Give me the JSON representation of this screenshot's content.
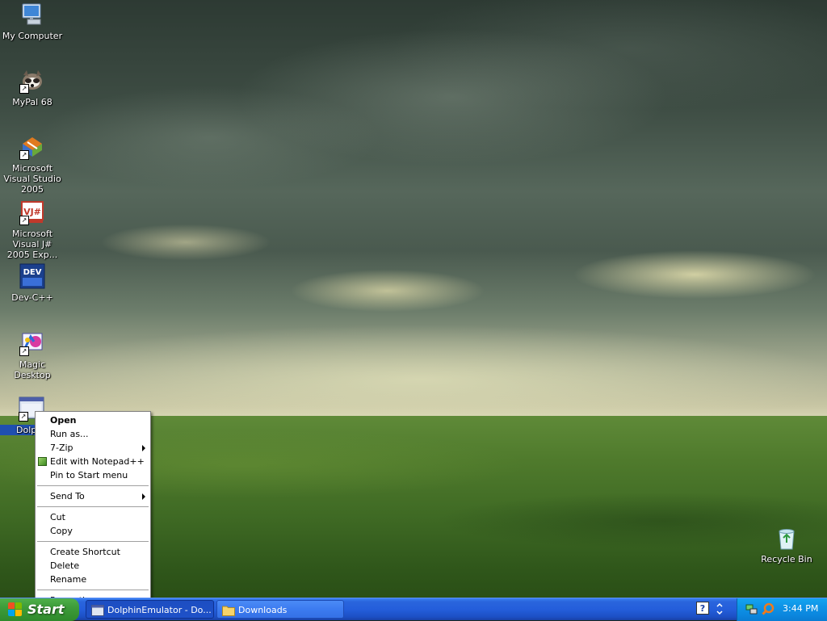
{
  "desktop": {
    "icons": [
      {
        "label": "My Computer"
      },
      {
        "label": "MyPal 68"
      },
      {
        "label": "Microsoft Visual Studio 2005"
      },
      {
        "label": "Microsoft Visual J# 2005 Exp..."
      },
      {
        "label": "Dev-C++"
      },
      {
        "label": "Magic Desktop"
      },
      {
        "label": "Dolp"
      },
      {
        "label": "Recycle Bin"
      }
    ]
  },
  "context_menu": {
    "items": [
      {
        "label": "Open"
      },
      {
        "label": "Run as..."
      },
      {
        "label": "7-Zip"
      },
      {
        "label": "Edit with Notepad++"
      },
      {
        "label": "Pin to Start menu"
      },
      {
        "label": "Send To"
      },
      {
        "label": "Cut"
      },
      {
        "label": "Copy"
      },
      {
        "label": "Create Shortcut"
      },
      {
        "label": "Delete"
      },
      {
        "label": "Rename"
      },
      {
        "label": "Properties"
      }
    ]
  },
  "taskbar": {
    "start_label": "Start",
    "windows": [
      {
        "label": "DolphinEmulator - Do..."
      },
      {
        "label": "Downloads"
      }
    ],
    "clock": "3:44 PM"
  },
  "colors": {
    "taskbar_blue": "#245edb",
    "start_green": "#3d9c3a",
    "tray_blue": "#0f96e8"
  }
}
